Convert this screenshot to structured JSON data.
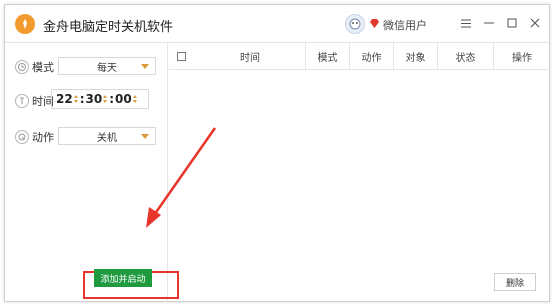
{
  "window": {
    "title": "金舟电脑定时关机软件"
  },
  "user": {
    "name": "微信用户"
  },
  "colors": {
    "accent": "#f39a2e",
    "start_button": "#1f9a3f",
    "highlight_red": "#e8352b"
  },
  "settings": {
    "mode": {
      "label": "模式",
      "value": "每天"
    },
    "time": {
      "label": "时间",
      "hour": "22",
      "minute": "30",
      "second": "00"
    },
    "action": {
      "label": "动作",
      "value": "关机"
    }
  },
  "buttons": {
    "start": "添加并启动",
    "delete": "删除"
  },
  "table": {
    "columns": [
      "时间",
      "模式",
      "动作",
      "对象",
      "状态",
      "操作"
    ],
    "rows": []
  },
  "icons": [
    "app-logo-icon",
    "avatar-icon",
    "vip-diamond-icon",
    "menu-icon",
    "minimize-icon",
    "maximize-icon",
    "close-icon",
    "clock-icon",
    "time-icon",
    "action-icon"
  ]
}
